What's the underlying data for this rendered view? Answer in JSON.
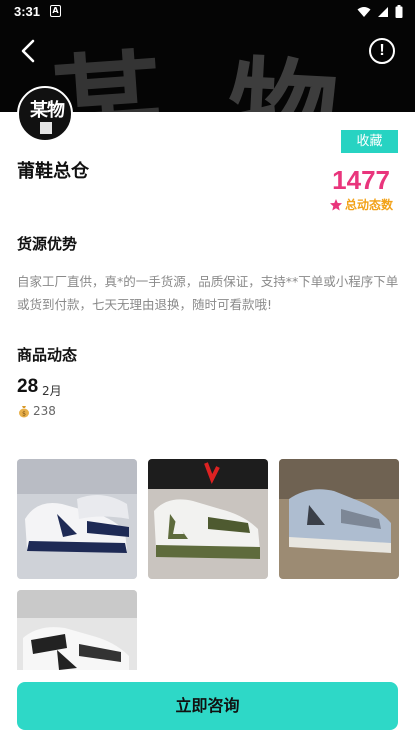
{
  "status_bar": {
    "time": "3:31",
    "a_badge": "A"
  },
  "header": {
    "banner_chars": [
      "某",
      "物"
    ],
    "avatar_text": "某物"
  },
  "shop": {
    "name": "莆鞋总仓",
    "collect_label": "收藏",
    "stat_number": "1477",
    "stat_label": "总动态数"
  },
  "advantage": {
    "title": "货源优势",
    "description": "自家工厂直供，真*的一手货源，品质保证，支持**下单或小程序下单或货到付款，七天无理由退换，随时可看款哦!"
  },
  "dynamics": {
    "title": "商品动态",
    "day": "28",
    "month": "2月",
    "views": "238"
  },
  "photos": [
    {
      "name": "white-navy-sneaker"
    },
    {
      "name": "white-olive-sneaker"
    },
    {
      "name": "grey-blue-sneaker"
    },
    {
      "name": "white-black-sneaker"
    }
  ],
  "cta": {
    "label": "立即咨询"
  },
  "colors": {
    "accent": "#2ed8c7",
    "stat": "#e9357c",
    "stat_label": "#f2a219"
  }
}
